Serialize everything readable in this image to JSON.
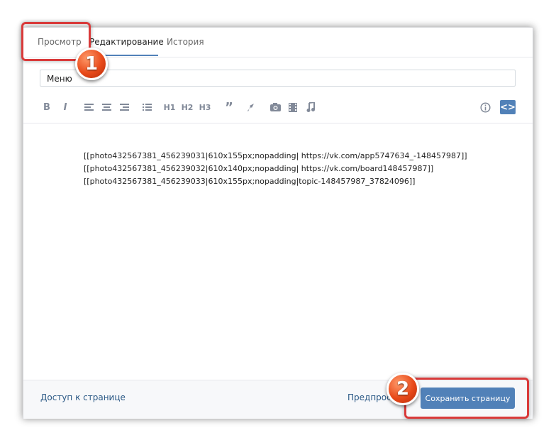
{
  "tabs": {
    "preview": "Просмотр",
    "editing": "Редактирование",
    "history": "История"
  },
  "title_input": {
    "value": "Меню"
  },
  "toolbar": {
    "bold": "B",
    "italic": "I",
    "h1": "H1",
    "h2": "H2",
    "h3": "H3",
    "quote": "”",
    "code": "<>"
  },
  "body_lines": [
    "[[photo432567381_456239031|610x155px;nopadding| https://vk.com/app5747634_-148457987]]",
    "[[photo432567381_456239032|610x140px;nopadding| https://vk.com/board148457987]]",
    "[[photo432567381_456239033|610x155px;nopadding|topic-148457987_37824096]]"
  ],
  "footer": {
    "access": "Доступ к странице",
    "preview": "Предпросмотр",
    "save": "Сохранить страницу"
  },
  "annotations": {
    "badge1": "1",
    "badge2": "2"
  },
  "colors": {
    "accent": "#5181b8",
    "link": "#2a5885",
    "highlight": "#d93a3a",
    "badge": "#e84a1a"
  }
}
